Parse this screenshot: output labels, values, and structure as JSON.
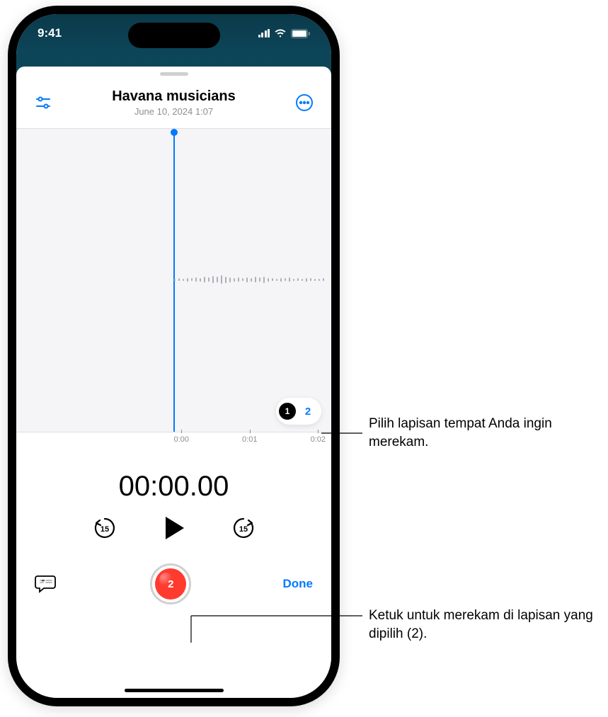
{
  "status": {
    "time": "9:41"
  },
  "header": {
    "title": "Havana musicians",
    "subtitle": "June 10, 2024  1:07"
  },
  "layers": {
    "layer1": "1",
    "layer2": "2"
  },
  "ruler": {
    "t0": "0:00",
    "t1": "0:01",
    "t2": "0:02"
  },
  "timecode": "00:00.00",
  "skip_value": "15",
  "record": {
    "layer_num": "2"
  },
  "buttons": {
    "done": "Done"
  },
  "callouts": {
    "layer": "Pilih lapisan tempat Anda ingin merekam.",
    "record": "Ketuk untuk merekam di lapisan yang dipilih (2)."
  }
}
